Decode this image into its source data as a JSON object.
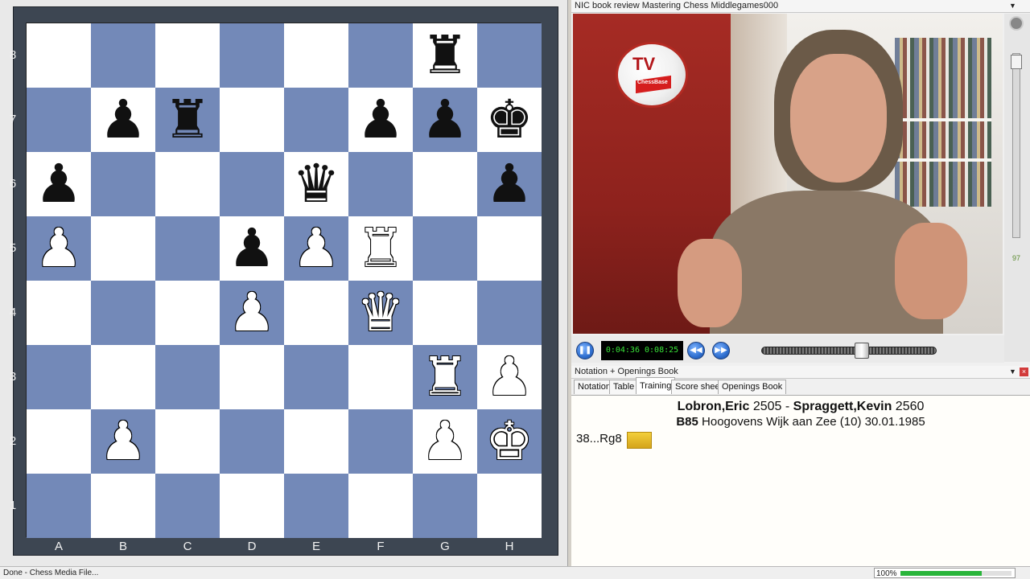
{
  "board": {
    "ranks": [
      "8",
      "7",
      "6",
      "5",
      "4",
      "3",
      "2",
      "1"
    ],
    "files": [
      "A",
      "B",
      "C",
      "D",
      "E",
      "F",
      "G",
      "H"
    ],
    "pieces": [
      {
        "square": "g8",
        "piece": "rook",
        "color": "b"
      },
      {
        "square": "b7",
        "piece": "pawn",
        "color": "b"
      },
      {
        "square": "c7",
        "piece": "rook",
        "color": "b"
      },
      {
        "square": "f7",
        "piece": "pawn",
        "color": "b"
      },
      {
        "square": "g7",
        "piece": "pawn",
        "color": "b"
      },
      {
        "square": "h7",
        "piece": "king",
        "color": "b"
      },
      {
        "square": "a6",
        "piece": "pawn",
        "color": "b"
      },
      {
        "square": "e6",
        "piece": "queen",
        "color": "b"
      },
      {
        "square": "h6",
        "piece": "pawn",
        "color": "b"
      },
      {
        "square": "a5",
        "piece": "pawn",
        "color": "w"
      },
      {
        "square": "d5",
        "piece": "pawn",
        "color": "b"
      },
      {
        "square": "e5",
        "piece": "pawn",
        "color": "w"
      },
      {
        "square": "f5",
        "piece": "rook",
        "color": "w"
      },
      {
        "square": "d4",
        "piece": "pawn",
        "color": "w"
      },
      {
        "square": "f4",
        "piece": "queen",
        "color": "w"
      },
      {
        "square": "g3",
        "piece": "rook",
        "color": "w"
      },
      {
        "square": "h3",
        "piece": "pawn",
        "color": "w"
      },
      {
        "square": "b2",
        "piece": "pawn",
        "color": "w"
      },
      {
        "square": "g2",
        "piece": "pawn",
        "color": "w"
      },
      {
        "square": "h2",
        "piece": "king",
        "color": "w"
      }
    ],
    "colors": {
      "light": "#ffffff",
      "dark": "#7389b8"
    }
  },
  "video": {
    "window_title": "NIC book review Mastering Chess Middlegames000",
    "time_current": "0:04:36",
    "time_total": "0:08:25",
    "progress": 0.58,
    "volume_level": "97",
    "logo": {
      "tv": "TV",
      "brand": "ChessBase"
    }
  },
  "notation": {
    "window_title": "Notation + Openings Book",
    "tabs": [
      "Notation",
      "Table",
      "Training",
      "Score sheet",
      "Openings Book"
    ],
    "active_tab": "Training",
    "white_player": "Lobron,Eric",
    "white_elo": "2505",
    "separator": "-",
    "black_player": "Spraggett,Kevin",
    "black_elo": "2560",
    "eco": "B85",
    "event": "Hoogovens Wijk aan Zee (10) 30.01.1985",
    "move": "38...Rg8"
  },
  "status": {
    "text": "Done - Chess Media File...",
    "zoom": "100%",
    "zoom_fill": 0.73
  },
  "icons": {
    "minimize": "▼",
    "close": "×",
    "pause": "❚❚",
    "rewind": "◀◀",
    "forward": "▶▶"
  }
}
